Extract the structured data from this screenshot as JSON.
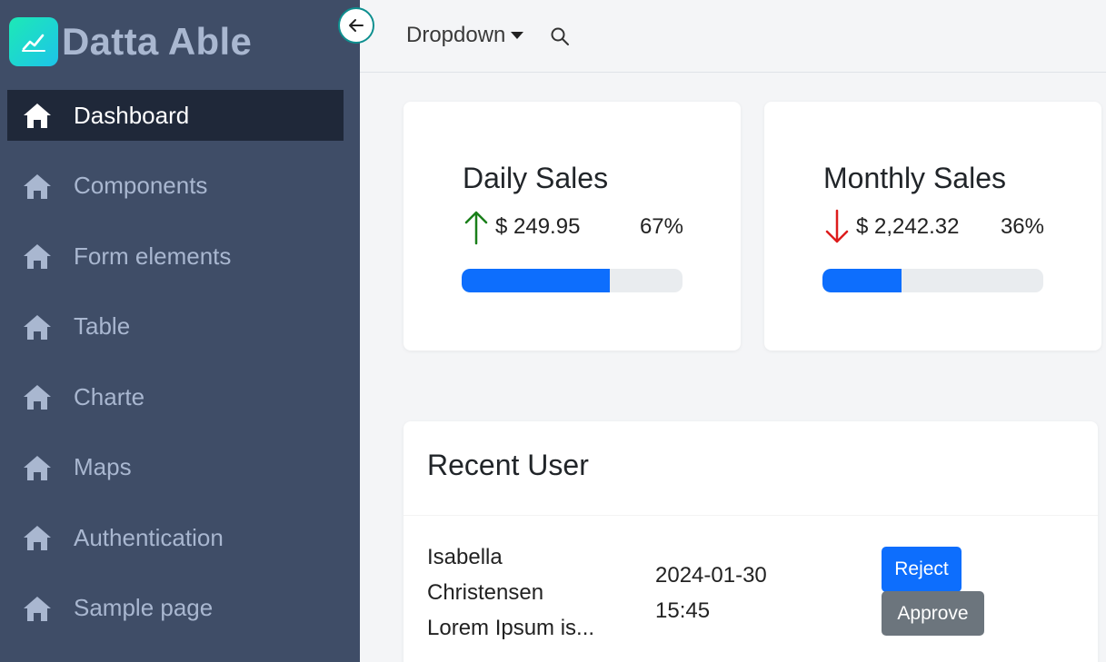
{
  "brand": {
    "name": "Datta Able",
    "logo_icon": "line-chart-icon",
    "logo_gradient": [
      "#1de9b6",
      "#1dc4e9"
    ]
  },
  "sidebar": {
    "bg_color": "#3f4d67",
    "active_bg_color": "#1f2839",
    "items": [
      {
        "label": "Dashboard",
        "icon": "home-icon",
        "active": true
      },
      {
        "label": "Components",
        "icon": "home-icon",
        "active": false
      },
      {
        "label": "Form elements",
        "icon": "home-icon",
        "active": false
      },
      {
        "label": "Table",
        "icon": "home-icon",
        "active": false
      },
      {
        "label": "Charte",
        "icon": "home-icon",
        "active": false
      },
      {
        "label": "Maps",
        "icon": "home-icon",
        "active": false
      },
      {
        "label": "Authentication",
        "icon": "home-icon",
        "active": false
      },
      {
        "label": "Sample page",
        "icon": "home-icon",
        "active": false
      }
    ]
  },
  "header": {
    "dropdown_label": "Dropdown",
    "search_icon": "search-icon",
    "collapse_icon": "arrow-left-icon"
  },
  "cards": [
    {
      "title": "Daily Sales",
      "amount": "$ 249.95",
      "percent": "67%",
      "progress": 67,
      "trend": "up",
      "trend_color": "#1a7f1a"
    },
    {
      "title": "Monthly Sales",
      "amount": "$ 2,242.32",
      "percent": "36%",
      "progress": 36,
      "trend": "down",
      "trend_color": "#dd1c1c"
    }
  ],
  "recent_user": {
    "title": "Recent User",
    "rows": [
      {
        "name_line1": "Isabella",
        "name_line2": "Christensen",
        "description": "Lorem Ipsum is...",
        "date": "2024-01-30",
        "time": "15:45",
        "reject_label": "Reject",
        "approve_label": "Approve"
      }
    ]
  },
  "colors": {
    "primary": "#0d6efd",
    "secondary": "#6c757d",
    "accent_teal": "#0e8f8f"
  }
}
